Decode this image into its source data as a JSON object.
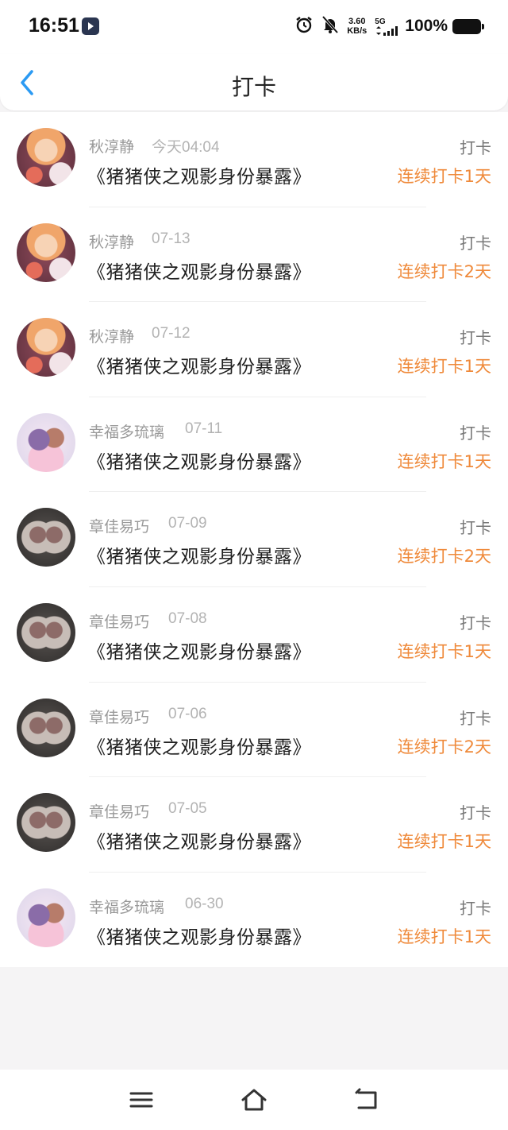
{
  "status_bar": {
    "time": "16:51",
    "net_speed_value": "3.60",
    "net_speed_unit": "KB/s",
    "signal_label": "5G",
    "battery_percent": "100%",
    "icons": [
      "alarm-icon",
      "mute-icon",
      "signal-icon",
      "battery-icon"
    ]
  },
  "header": {
    "title": "打卡",
    "back_icon": "chevron-left-icon",
    "accent_color": "#2b9af3"
  },
  "colors": {
    "streak": "#ef8a3b",
    "meta": "#999999"
  },
  "checkins": [
    {
      "user": "秋淳静",
      "date": "今天04:04",
      "book": "《猪猪侠之观影身份暴露》",
      "action": "打卡",
      "streak": "连续打卡1天",
      "avatar": "avatar-1"
    },
    {
      "user": "秋淳静",
      "date": "07-13",
      "book": "《猪猪侠之观影身份暴露》",
      "action": "打卡",
      "streak": "连续打卡2天",
      "avatar": "avatar-1"
    },
    {
      "user": "秋淳静",
      "date": "07-12",
      "book": "《猪猪侠之观影身份暴露》",
      "action": "打卡",
      "streak": "连续打卡1天",
      "avatar": "avatar-1"
    },
    {
      "user": "幸福多琉璃",
      "date": "07-11",
      "book": "《猪猪侠之观影身份暴露》",
      "action": "打卡",
      "streak": "连续打卡1天",
      "avatar": "avatar-2"
    },
    {
      "user": "章佳易巧",
      "date": "07-09",
      "book": "《猪猪侠之观影身份暴露》",
      "action": "打卡",
      "streak": "连续打卡2天",
      "avatar": "avatar-3"
    },
    {
      "user": "章佳易巧",
      "date": "07-08",
      "book": "《猪猪侠之观影身份暴露》",
      "action": "打卡",
      "streak": "连续打卡1天",
      "avatar": "avatar-3"
    },
    {
      "user": "章佳易巧",
      "date": "07-06",
      "book": "《猪猪侠之观影身份暴露》",
      "action": "打卡",
      "streak": "连续打卡2天",
      "avatar": "avatar-3"
    },
    {
      "user": "章佳易巧",
      "date": "07-05",
      "book": "《猪猪侠之观影身份暴露》",
      "action": "打卡",
      "streak": "连续打卡1天",
      "avatar": "avatar-3"
    },
    {
      "user": "幸福多琉璃",
      "date": "06-30",
      "book": "《猪猪侠之观影身份暴露》",
      "action": "打卡",
      "streak": "连续打卡1天",
      "avatar": "avatar-2"
    }
  ],
  "bottom_nav": {
    "icons": [
      "menu-icon",
      "home-icon",
      "back-icon"
    ]
  }
}
